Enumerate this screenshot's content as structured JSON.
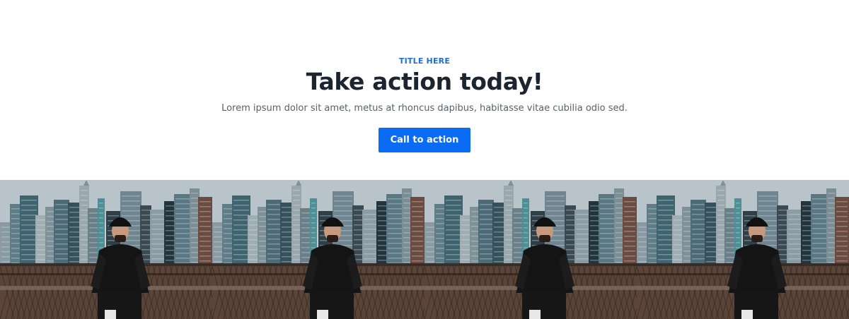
{
  "hero": {
    "eyebrow": "TITLE HERE",
    "headline": "Take action today!",
    "subtext": "Lorem ipsum dolor sit amet, metus at rhoncus dapibus, habitasse vitae cubilia odio sed.",
    "cta_label": "Call to action"
  },
  "colors": {
    "accent": "#0a6cf5",
    "eyebrow": "#1b6fe0",
    "headline": "#1c2430",
    "body": "#5a6068"
  },
  "gallery": {
    "photo_subject": "man-on-bridge-city-skyline-photo",
    "tiles": [
      {
        "name": "gallery-photo-1"
      },
      {
        "name": "gallery-photo-2"
      },
      {
        "name": "gallery-photo-3"
      },
      {
        "name": "gallery-photo-4"
      }
    ]
  }
}
